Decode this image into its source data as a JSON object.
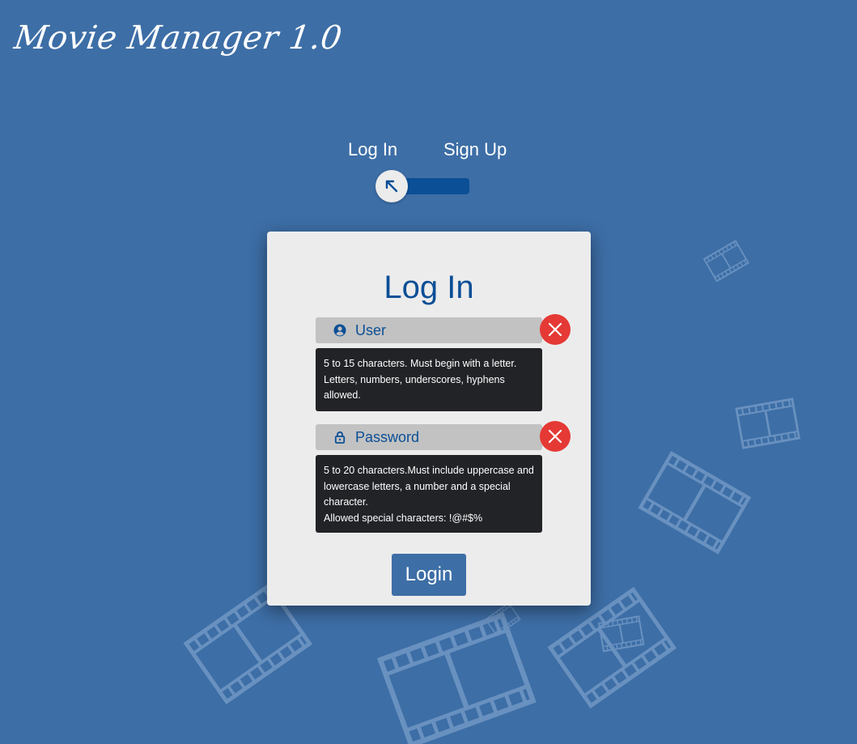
{
  "app": {
    "logo_text": "Movie Manager 1.0"
  },
  "mode_tabs": {
    "login_label": "Log In",
    "signup_label": "Sign Up",
    "active": "Log In"
  },
  "login_card": {
    "title": "Log In",
    "user_field": {
      "placeholder": "User",
      "value": "",
      "icon": "user-circle-icon",
      "status_icon": "error-x-icon",
      "hint": "5 to 15 characters. Must begin with a letter. Letters, numbers, underscores, hyphens allowed."
    },
    "password_field": {
      "placeholder": "Password",
      "value": "",
      "icon": "lock-icon",
      "status_icon": "error-x-icon",
      "hint_line1": "5 to 20 characters.Must include uppercase and lowercase letters, a number and a special character.",
      "hint_line2": "Allowed special characters: !@#$%"
    },
    "submit_label": "Login"
  },
  "colors": {
    "background": "#3d6ea6",
    "accent": "#0b4f96",
    "card": "#ececec",
    "field": "#c2c2c2",
    "error": "#e53935",
    "hint_bg": "#222327"
  }
}
